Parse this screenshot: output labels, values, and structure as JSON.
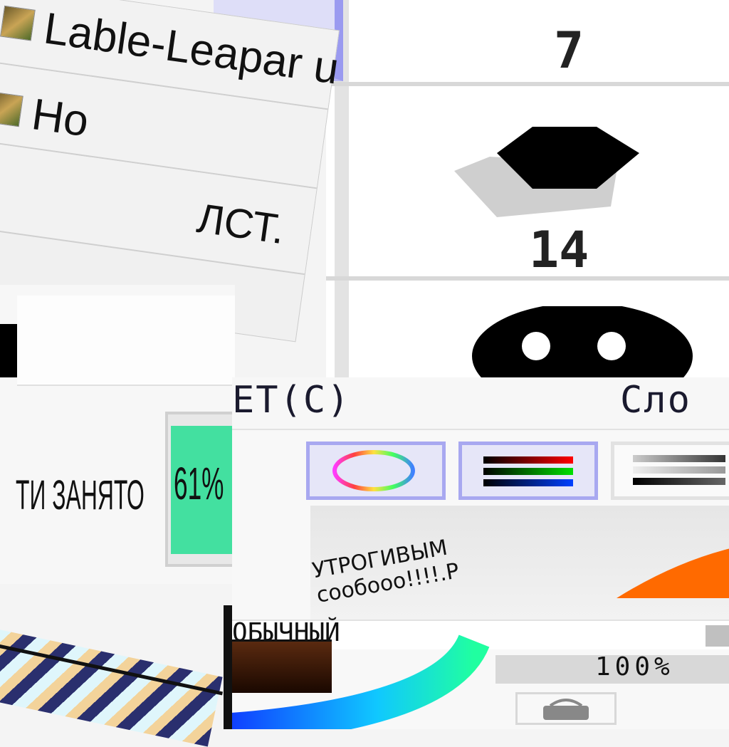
{
  "documents": [
    {
      "title": "Lable-Leapar u"
    },
    {
      "title": "Ho"
    }
  ],
  "left_fragment": "ЛСТ.",
  "right_panel": {
    "number_top": "7",
    "number_mid": "14"
  },
  "memory": {
    "label": "ТИ ЗАНЯТО",
    "value": "61%",
    "value_fraction": 0.61,
    "bar_color": "#43e0a0"
  },
  "color_menu": {
    "menu_color": "ЕТ(С)",
    "menu_layer": "Сло"
  },
  "color_tools": [
    {
      "name": "color-wheel"
    },
    {
      "name": "rgb-sliders"
    },
    {
      "name": "grayscale-sliders"
    }
  ],
  "sticker_text": {
    "line1": "УТРОГИВЫМ",
    "line2": "сообооо!!!!.Р"
  },
  "partial_label": "ОБЫЧНЫЙ",
  "opacity": {
    "value_text": "100%",
    "value": 100
  },
  "colors": {
    "accent": "#a8a8f0",
    "memory_green": "#43e0a0",
    "orange": "#ff6a00",
    "current_brown": "#5a2a10"
  }
}
